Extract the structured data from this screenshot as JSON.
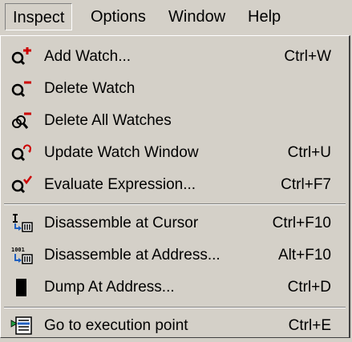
{
  "menubar": {
    "items": [
      {
        "label": "Inspect"
      },
      {
        "label": "Options"
      },
      {
        "label": "Window"
      },
      {
        "label": "Help"
      }
    ]
  },
  "menu": {
    "items": [
      {
        "label": "Add Watch...",
        "shortcut": "Ctrl+W",
        "icon": "add-watch-icon"
      },
      {
        "label": "Delete Watch",
        "shortcut": "",
        "icon": "delete-watch-icon"
      },
      {
        "label": "Delete All Watches",
        "shortcut": "",
        "icon": "delete-all-watches-icon"
      },
      {
        "label": "Update Watch Window",
        "shortcut": "Ctrl+U",
        "icon": "update-watch-icon"
      },
      {
        "label": "Evaluate Expression...",
        "shortcut": "Ctrl+F7",
        "icon": "evaluate-expression-icon"
      },
      {
        "label": "Disassemble at Cursor",
        "shortcut": "Ctrl+F10",
        "icon": "disassemble-cursor-icon"
      },
      {
        "label": "Disassemble at Address...",
        "shortcut": "Alt+F10",
        "icon": "disassemble-address-icon"
      },
      {
        "label": "Dump At Address...",
        "shortcut": "Ctrl+D",
        "icon": "dump-address-icon"
      },
      {
        "label": "Go to execution point",
        "shortcut": "Ctrl+E",
        "icon": "execution-point-icon"
      }
    ]
  },
  "colors": {
    "face": "#d4d0c8",
    "shadow": "#808080",
    "highlight": "#ffffff",
    "accent_red": "#cc0000"
  }
}
